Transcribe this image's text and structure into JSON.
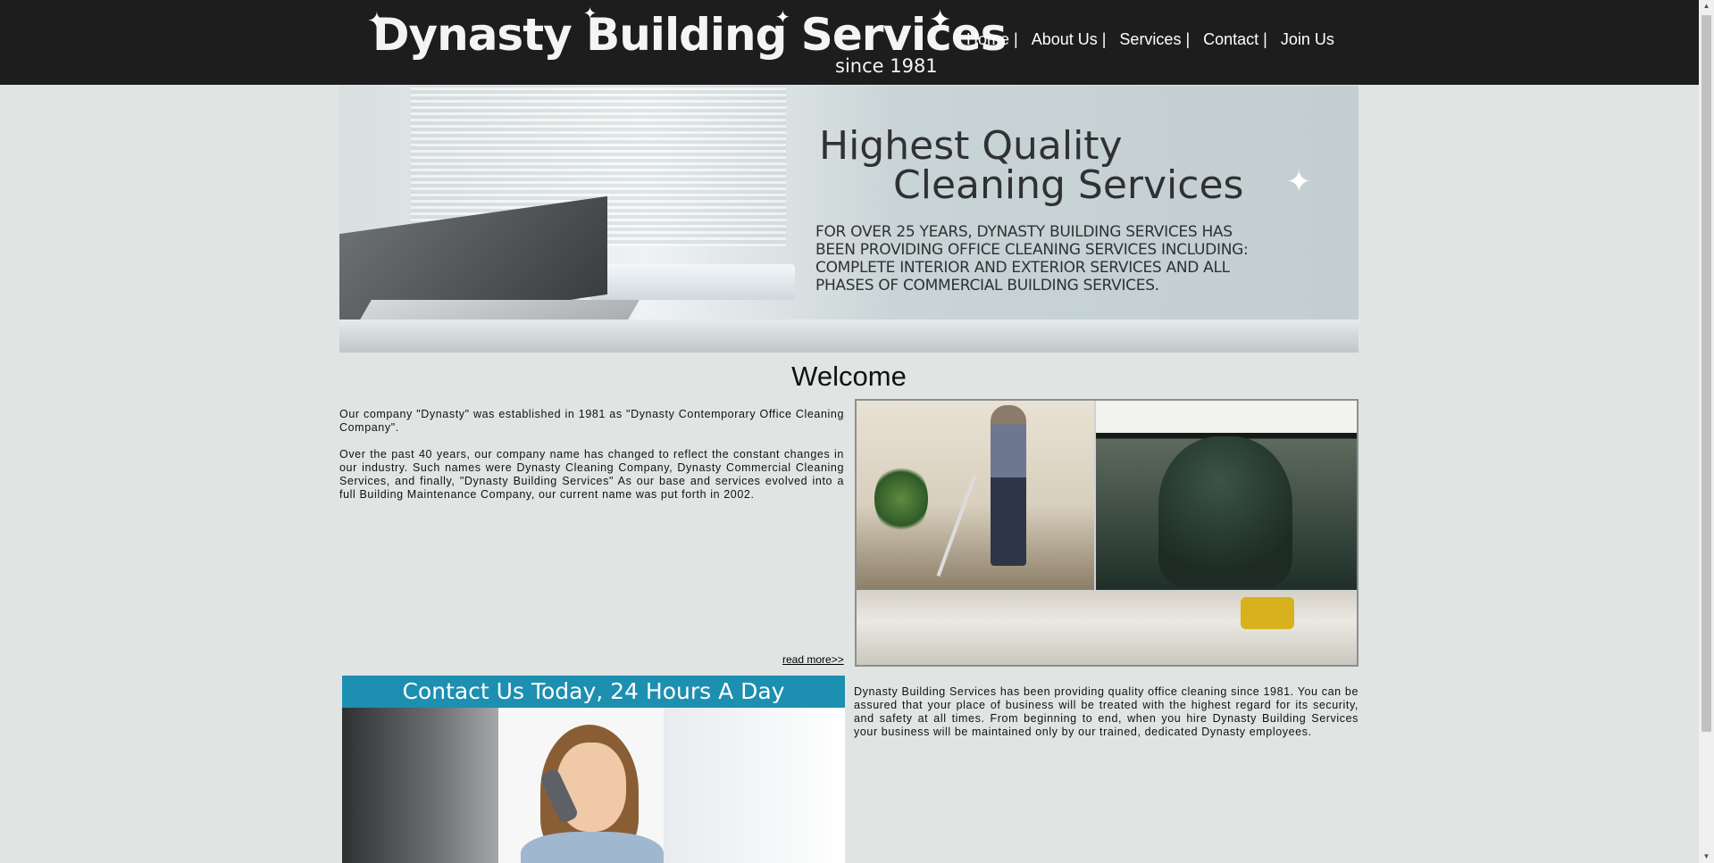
{
  "header": {
    "logo_name": "Dynasty Building Services",
    "logo_since": "since 1981",
    "nav": [
      "Home |",
      "About Us |",
      "Services |",
      "Contact |",
      "Join Us"
    ]
  },
  "hero": {
    "title_line1": "Highest Quality",
    "title_line2": "Cleaning Services",
    "blurb_lines": [
      "FOR OVER 25 YEARS, DYNASTY BUILDING SERVICES HAS",
      "BEEN PROVIDING OFFICE CLEANING SERVICES INCLUDING:",
      "COMPLETE INTERIOR AND EXTERIOR SERVICES AND ALL",
      "PHASES OF COMMERCIAL BUILDING SERVICES."
    ]
  },
  "welcome": {
    "heading": "Welcome",
    "para1": "Our company \"Dynasty\" was established in 1981 as \"Dynasty Contemporary Office Cleaning Company\".",
    "para2": "Over the past 40 years, our company name has changed to reflect the constant changes in our industry. Such names were Dynasty Cleaning Company, Dynasty Commercial Cleaning Services, and finally, \"Dynasty Building Services\" As our base and services evolved into a full Building Maintenance Company, our current name was put forth in 2002.",
    "read_more": "read more>>"
  },
  "contact_banner": {
    "text": "Contact Us Today, 24 Hours A Day"
  },
  "quality": {
    "text": "Dynasty Building Services has been providing quality office cleaning since 1981. You can be assured that your place of business will be treated with the highest regard for its security, and safety at all times. From beginning to end, when you hire Dynasty Building Services your business will be maintained only by our trained, dedicated Dynasty employees."
  },
  "scroll": {
    "up_glyph": "▲",
    "down_glyph": "▼"
  }
}
